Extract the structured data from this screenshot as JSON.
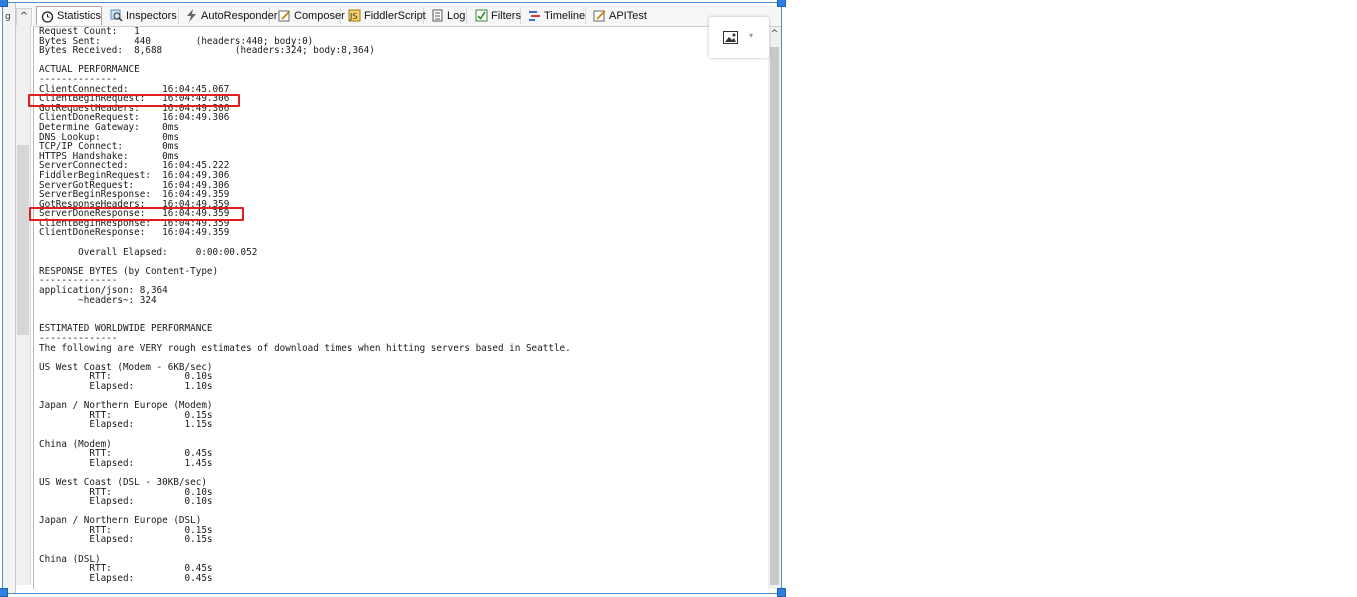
{
  "tabs": [
    {
      "label": "Statistics",
      "icon": "stopwatch-icon",
      "active": true
    },
    {
      "label": "Inspectors",
      "icon": "magnifier-icon",
      "active": false
    },
    {
      "label": "AutoResponder",
      "icon": "lightning-icon",
      "active": false
    },
    {
      "label": "Composer",
      "icon": "pencil-form-icon",
      "active": false
    },
    {
      "label": "FiddlerScript",
      "icon": "script-icon",
      "active": false
    },
    {
      "label": "Log",
      "icon": "document-icon",
      "active": false
    },
    {
      "label": "Filters",
      "icon": "checkbox-icon",
      "active": false
    },
    {
      "label": "Timeline",
      "icon": "timeline-icon",
      "active": false
    },
    {
      "label": "APITest",
      "icon": "edit-icon",
      "active": false
    }
  ],
  "statistics": {
    "lines": [
      "Request Count:   1",
      "Bytes Sent:      440        (headers:440; body:0)",
      "Bytes Received:  8,688             (headers:324; body:8,364)",
      "",
      "ACTUAL PERFORMANCE",
      "--------------",
      "ClientConnected:      16:04:45.067",
      "ClientBeginRequest:   16:04:49.306",
      "GotRequestHeaders:    16:04:49.306",
      "ClientDoneRequest:    16:04:49.306",
      "Determine Gateway:    0ms",
      "DNS Lookup:           0ms",
      "TCP/IP Connect:       0ms",
      "HTTPS Handshake:      0ms",
      "ServerConnected:      16:04:45.222",
      "FiddlerBeginRequest:  16:04:49.306",
      "ServerGotRequest:     16:04:49.306",
      "ServerBeginResponse:  16:04:49.359",
      "GotResponseHeaders:   16:04:49.359",
      "ServerDoneResponse:   16:04:49.359",
      "ClientBeginResponse:  16:04:49.359",
      "ClientDoneResponse:   16:04:49.359",
      "",
      "       Overall Elapsed:     0:00:00.052",
      "",
      "RESPONSE BYTES (by Content-Type)",
      "--------------",
      "application/json: 8,364",
      "       ~headers~: 324",
      "",
      "",
      "ESTIMATED WORLDWIDE PERFORMANCE",
      "--------------",
      "The following are VERY rough estimates of download times when hitting servers based in Seattle.",
      "",
      "US West Coast (Modem - 6KB/sec)",
      "         RTT:             0.10s",
      "         Elapsed:         1.10s",
      "",
      "Japan / Northern Europe (Modem)",
      "         RTT:             0.15s",
      "         Elapsed:         1.15s",
      "",
      "China (Modem)",
      "         RTT:             0.45s",
      "         Elapsed:         1.45s",
      "",
      "US West Coast (DSL - 30KB/sec)",
      "         RTT:             0.10s",
      "         Elapsed:         0.10s",
      "",
      "Japan / Northern Europe (DSL)",
      "         RTT:             0.15s",
      "         Elapsed:         0.15s",
      "",
      "China (DSL)",
      "         RTT:             0.45s",
      "         Elapsed:         0.45s"
    ]
  },
  "highlight_color": "#e02020",
  "left_strip_glyph": "g",
  "collapse_glyph": "^",
  "scroll_up_glyph": "^",
  "image_button": {
    "icon": "image-icon",
    "dropdown": "▾"
  }
}
